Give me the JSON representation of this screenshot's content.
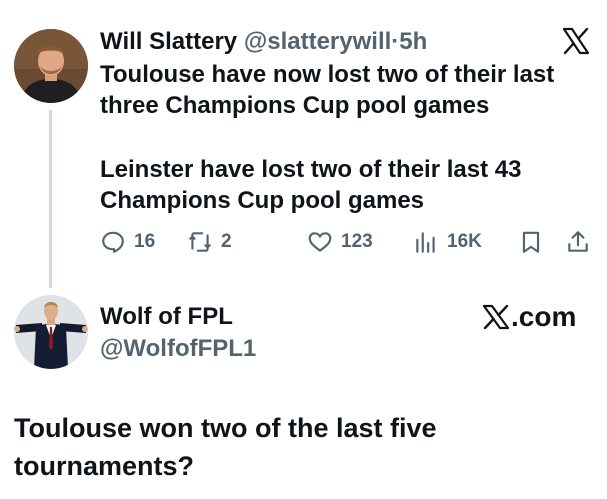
{
  "tweet1": {
    "author_name": "Will Slattery",
    "handle": "@slatterywill",
    "separator": "·",
    "time": "5h",
    "text_line1": "Toulouse have now lost two of their last three Champions Cup pool games",
    "text_line2": "Leinster have lost two of their last 43 Champions Cup pool games",
    "actions": {
      "replies": "16",
      "retweets": "2",
      "likes": "123",
      "views": "16K"
    }
  },
  "tweet2": {
    "author_name": "Wolf of FPL",
    "handle": "@WolfofFPL1",
    "brand_label": ".com",
    "text": "Toulouse won two of the last five tournaments?"
  },
  "icons": {
    "header_logo": "x-logo-icon",
    "reply": "reply-icon",
    "retweet": "retweet-icon",
    "like": "heart-icon",
    "views": "views-icon",
    "bookmark": "bookmark-icon",
    "share": "share-icon"
  },
  "colors": {
    "text_primary": "#0f1419",
    "text_secondary": "#536471",
    "thread_line": "#cfd9de"
  }
}
